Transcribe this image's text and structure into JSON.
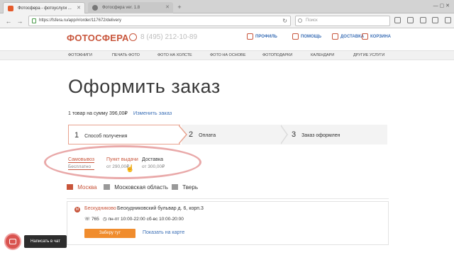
{
  "browser": {
    "tabs": [
      {
        "title": "Фотосфера - фотоуслуги ...",
        "active": true
      },
      {
        "title": "Фотосфера ver. 1.8",
        "active": false
      }
    ],
    "url": "https://fsfera.ru/app/#/order/117672/delivery",
    "search_placeholder": "Поиск"
  },
  "header": {
    "logo": "ФОТОСФЕРА",
    "phone": "8 (495) 212-10-89",
    "links": [
      {
        "label": "ПРОФИЛЬ",
        "icon": "profile-icon"
      },
      {
        "label": "ПОМОЩЬ",
        "icon": "help-icon"
      },
      {
        "label": "ДОСТАВКА",
        "icon": "delivery-icon"
      },
      {
        "label": "КОРЗИНА",
        "icon": "cart-icon"
      }
    ]
  },
  "menu": [
    "ФОТОКНИГИ",
    "ПЕЧАТЬ ФОТО",
    "ФОТО НА ХОЛСТЕ",
    "ФОТО НА ОСНОВЕ",
    "ФОТОПОДАРКИ",
    "КАЛЕНДАРИ",
    "ДРУГИЕ УСЛУГИ"
  ],
  "page": {
    "title": "Оформить заказ",
    "summary": "1 товар на сумму",
    "summary_amount": "396,00₽",
    "edit_order": "Изменить заказ"
  },
  "steps": [
    {
      "num": "1",
      "label": "Способ получения"
    },
    {
      "num": "2",
      "label": "Оплата"
    },
    {
      "num": "3",
      "label": "Заказ оформлен"
    }
  ],
  "delivery_options": [
    {
      "title": "Самовывоз",
      "sub": "Бесплатно"
    },
    {
      "title": "Пункт выдачи",
      "sub": "от 290,00₽"
    },
    {
      "title": "Доставка",
      "sub": "от 300,00₽"
    }
  ],
  "cities": [
    "Москва",
    "Московская область",
    "Тверь"
  ],
  "pickup_point": {
    "station": "Бескудниково",
    "address": "Бескудниковский бульвар д. 6, корп.3",
    "phone": "765",
    "hours": "пн-пт 10:00-22:00 сб-вс 10:00-20:00",
    "pick_button": "Заберу тут",
    "map_link": "Показать на карте"
  },
  "chat": {
    "label": "Написать в чат"
  },
  "colors": {
    "brand": "#c8553b",
    "link": "#3b6fb6",
    "button": "#f08c2d",
    "highlight": "#e9a9a9"
  }
}
